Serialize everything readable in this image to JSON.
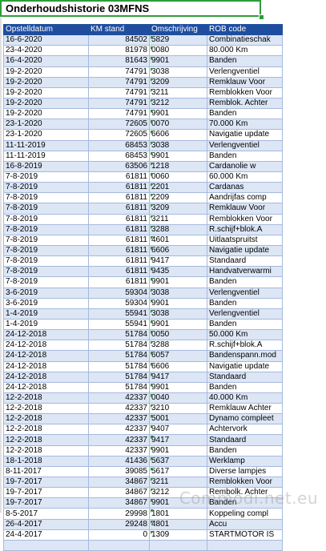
{
  "sheet": {
    "title": "Onderhoudshistorie 03MFNS",
    "columns": [
      "Opstelldatum",
      "KM stand",
      "Omschrijving",
      "ROB code"
    ],
    "rows": [
      [
        "16-6-2020",
        "84502",
        "5829",
        "Combinatieschak"
      ],
      [
        "23-4-2020",
        "81978",
        "0080",
        "80.000 Km"
      ],
      [
        "16-4-2020",
        "81643",
        "9901",
        "Banden"
      ],
      [
        "19-2-2020",
        "74791",
        "3038",
        "Verlengventiel"
      ],
      [
        "19-2-2020",
        "74791",
        "3209",
        "Remklauw Voor"
      ],
      [
        "19-2-2020",
        "74791",
        "3211",
        "Remblokken Voor"
      ],
      [
        "19-2-2020",
        "74791",
        "3212",
        "Remblok. Achter"
      ],
      [
        "19-2-2020",
        "74791",
        "9901",
        "Banden"
      ],
      [
        "23-1-2020",
        "72605",
        "0070",
        "70.000 Km"
      ],
      [
        "23-1-2020",
        "72605",
        "6606",
        "Navigatie update"
      ],
      [
        "11-11-2019",
        "68453",
        "3038",
        "Verlengventiel"
      ],
      [
        "11-11-2019",
        "68453",
        "9901",
        "Banden"
      ],
      [
        "16-8-2019",
        "63506",
        "1218",
        "Cardanolie w"
      ],
      [
        "7-8-2019",
        "61811",
        "0060",
        "60.000 Km"
      ],
      [
        "7-8-2019",
        "61811",
        "2201",
        "Cardanas"
      ],
      [
        "7-8-2019",
        "61811",
        "2209",
        "Aandrijfas comp"
      ],
      [
        "7-8-2019",
        "61811",
        "3209",
        "Remklauw Voor"
      ],
      [
        "7-8-2019",
        "61811",
        "3211",
        "Remblokken Voor"
      ],
      [
        "7-8-2019",
        "61811",
        "3288",
        "R.schijf+blok.A"
      ],
      [
        "7-8-2019",
        "61811",
        "4601",
        "Uitlaatspruitst"
      ],
      [
        "7-8-2019",
        "61811",
        "6606",
        "Navigatie update"
      ],
      [
        "7-8-2019",
        "61811",
        "9417",
        "Standaard"
      ],
      [
        "7-8-2019",
        "61811",
        "9435",
        "Handvatverwarmi"
      ],
      [
        "7-8-2019",
        "61811",
        "9901",
        "Banden"
      ],
      [
        "3-6-2019",
        "59304",
        "3038",
        "Verlengventiel"
      ],
      [
        "3-6-2019",
        "59304",
        "9901",
        "Banden"
      ],
      [
        "1-4-2019",
        "55941",
        "3038",
        "Verlengventiel"
      ],
      [
        "1-4-2019",
        "55941",
        "9901",
        "Banden"
      ],
      [
        "24-12-2018",
        "51784",
        "0050",
        "50.000 Km"
      ],
      [
        "24-12-2018",
        "51784",
        "3288",
        "R.schijf+blok.A"
      ],
      [
        "24-12-2018",
        "51784",
        "6057",
        "Bandenspann.mod"
      ],
      [
        "24-12-2018",
        "51784",
        "6606",
        "Navigatie update"
      ],
      [
        "24-12-2018",
        "51784",
        "9417",
        "Standaard"
      ],
      [
        "24-12-2018",
        "51784",
        "9901",
        "Banden"
      ],
      [
        "12-2-2018",
        "42337",
        "0040",
        "40.000 Km"
      ],
      [
        "12-2-2018",
        "42337",
        "3210",
        "Remklauw Achter"
      ],
      [
        "12-2-2018",
        "42337",
        "5001",
        "Dynamo compleet"
      ],
      [
        "12-2-2018",
        "42337",
        "9407",
        "Achtervork"
      ],
      [
        "12-2-2018",
        "42337",
        "9417",
        "Standaard"
      ],
      [
        "12-2-2018",
        "42337",
        "9901",
        "Banden"
      ],
      [
        "18-1-2018",
        "41436",
        "5637",
        "Werklamp"
      ],
      [
        "8-11-2017",
        "39085",
        "5617",
        "Diverse lampjes"
      ],
      [
        "19-7-2017",
        "34867",
        "3211",
        "Remblokken Voor"
      ],
      [
        "19-7-2017",
        "34867",
        "3212",
        "Rembolk. Achter"
      ],
      [
        "19-7-2017",
        "34867",
        "9901",
        "Banden"
      ],
      [
        "8-5-2017",
        "29998",
        "1801",
        "Koppeling compl"
      ],
      [
        "26-4-2017",
        "29248",
        "4801",
        "Accu"
      ],
      [
        "24-4-2017",
        "0",
        "1309",
        "STARTMOTOR IS"
      ],
      [
        "",
        "",
        "",
        ""
      ]
    ]
  },
  "watermark": "Commodi.net.eu",
  "colors": {
    "header_bg": "#1f4e9e",
    "header_text": "#ffffff",
    "alt_row_bg": "#dce6f5",
    "selection_border": "#2e9d3a",
    "code_marker": "#2e8b3a"
  }
}
